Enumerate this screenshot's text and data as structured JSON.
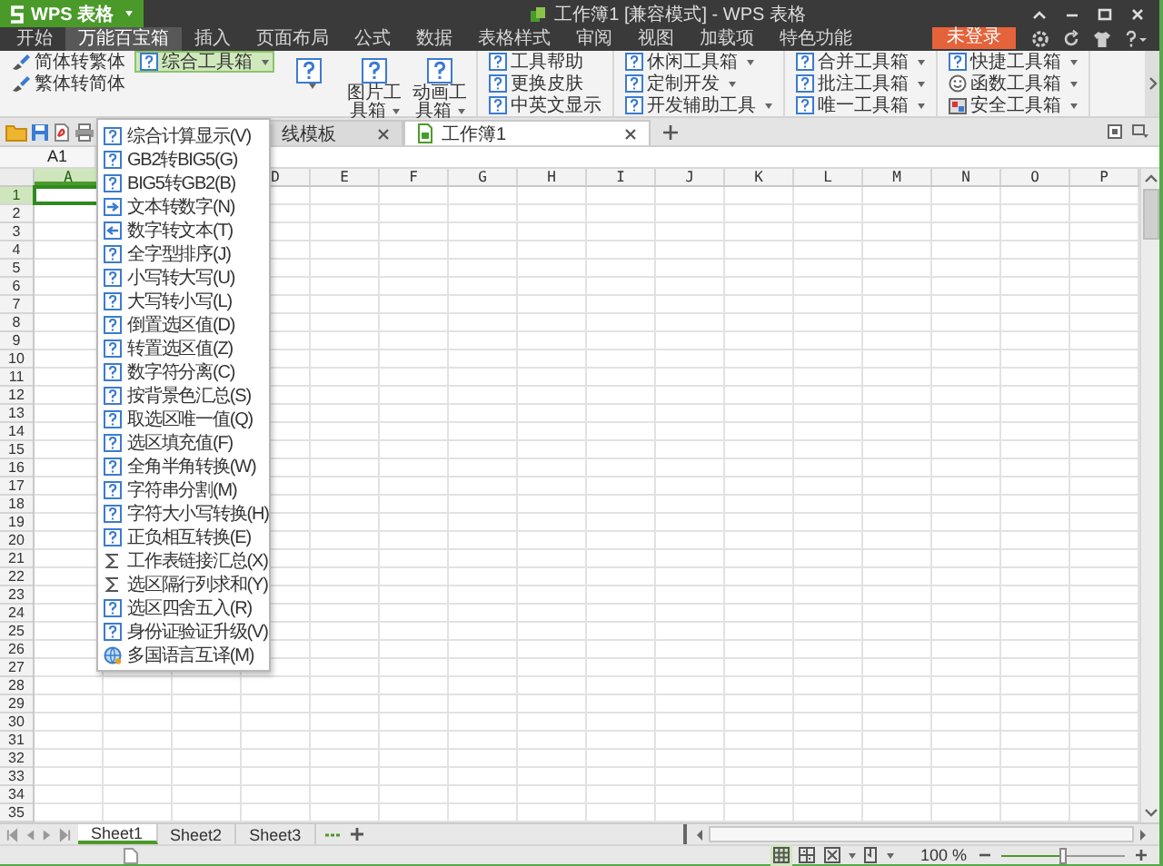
{
  "app_button": {
    "label": "WPS 表格"
  },
  "window": {
    "title": "工作簿1 [兼容模式] - WPS 表格"
  },
  "menu_tabs": [
    {
      "label": "开始",
      "selected": false
    },
    {
      "label": "万能百宝箱",
      "selected": true
    },
    {
      "label": "插入",
      "selected": false
    },
    {
      "label": "页面布局",
      "selected": false
    },
    {
      "label": "公式",
      "selected": false
    },
    {
      "label": "数据",
      "selected": false
    },
    {
      "label": "表格样式",
      "selected": false
    },
    {
      "label": "审阅",
      "selected": false
    },
    {
      "label": "视图",
      "selected": false
    },
    {
      "label": "加载项",
      "selected": false
    },
    {
      "label": "特色功能",
      "selected": false
    }
  ],
  "login_button": {
    "label": "未登录"
  },
  "ribbon": {
    "groups": [
      {
        "columns": [
          [
            {
              "kind": "brush",
              "label": "简体转繁体",
              "dropdown": false,
              "selected": false
            },
            {
              "kind": "brush",
              "label": "繁体转简体",
              "dropdown": false,
              "selected": false
            }
          ],
          [
            {
              "kind": "help",
              "label": "综合工具箱",
              "dropdown": true,
              "selected": true
            }
          ],
          [
            {
              "kind": "large",
              "dropdown": true,
              "selected": false
            }
          ],
          [
            {
              "kind": "large",
              "label": "图片工具箱",
              "dropdown": true,
              "selected": false
            }
          ],
          [
            {
              "kind": "large",
              "label": "动画工具箱",
              "dropdown": true,
              "selected": false
            }
          ]
        ]
      },
      {
        "columns": [
          [
            {
              "kind": "help",
              "label": "工具帮助",
              "dropdown": false,
              "selected": false
            },
            {
              "kind": "help",
              "label": "更换皮肤",
              "dropdown": false,
              "selected": false
            },
            {
              "kind": "help",
              "label": "中英文显示",
              "dropdown": false,
              "selected": false
            }
          ]
        ]
      },
      {
        "columns": [
          [
            {
              "kind": "help",
              "label": "休闲工具箱",
              "dropdown": true,
              "selected": false
            },
            {
              "kind": "help",
              "label": "定制开发",
              "dropdown": true,
              "selected": false
            },
            {
              "kind": "help",
              "label": "开发辅助工具",
              "dropdown": true,
              "selected": false
            }
          ]
        ]
      },
      {
        "columns": [
          [
            {
              "kind": "help",
              "label": "合并工具箱",
              "dropdown": true,
              "selected": false
            },
            {
              "kind": "help",
              "label": "批注工具箱",
              "dropdown": true,
              "selected": false
            },
            {
              "kind": "help",
              "label": "唯一工具箱",
              "dropdown": true,
              "selected": false
            }
          ]
        ]
      },
      {
        "columns": [
          [
            {
              "kind": "help",
              "label": "快捷工具箱",
              "dropdown": true,
              "selected": false
            },
            {
              "kind": "circle",
              "label": "函数工具箱",
              "dropdown": true,
              "selected": false
            },
            {
              "kind": "box",
              "label": "安全工具箱",
              "dropdown": true,
              "selected": false
            }
          ]
        ]
      }
    ]
  },
  "doc_tabs": [
    {
      "label": "线模板",
      "selected": false
    },
    {
      "label": "工作簿1",
      "selected": true
    }
  ],
  "name_box": "A1",
  "columns": [
    {
      "label": "A",
      "selected": true
    },
    {
      "covered": true
    },
    {
      "covered": true
    },
    {
      "label": "D",
      "selected": false
    },
    {
      "label": "E",
      "selected": false
    },
    {
      "label": "F",
      "selected": false
    },
    {
      "label": "G",
      "selected": false
    },
    {
      "label": "H",
      "selected": false
    },
    {
      "label": "I",
      "selected": false
    },
    {
      "label": "J",
      "selected": false
    },
    {
      "label": "K",
      "selected": false
    },
    {
      "label": "L",
      "selected": false
    },
    {
      "label": "M",
      "selected": false
    },
    {
      "label": "N",
      "selected": false
    },
    {
      "label": "O",
      "selected": false
    },
    {
      "label": "P",
      "selected": false
    }
  ],
  "rows": [
    {
      "label": "1",
      "selected": true
    },
    {
      "label": "2",
      "selected": false
    },
    {
      "label": "3",
      "selected": false
    },
    {
      "label": "4",
      "selected": false
    },
    {
      "label": "5",
      "selected": false
    },
    {
      "label": "6",
      "selected": false
    },
    {
      "label": "7",
      "selected": false
    },
    {
      "label": "8",
      "selected": false
    },
    {
      "label": "9",
      "selected": false
    },
    {
      "label": "10",
      "selected": false
    },
    {
      "label": "11",
      "selected": false
    },
    {
      "label": "12",
      "selected": false
    },
    {
      "label": "13",
      "selected": false
    },
    {
      "label": "14",
      "selected": false
    },
    {
      "label": "15",
      "selected": false
    },
    {
      "label": "16",
      "selected": false
    },
    {
      "label": "17",
      "selected": false
    },
    {
      "label": "18",
      "selected": false
    },
    {
      "label": "19",
      "selected": false
    },
    {
      "label": "20",
      "selected": false
    },
    {
      "label": "21",
      "selected": false
    },
    {
      "label": "22",
      "selected": false
    },
    {
      "label": "23",
      "selected": false
    },
    {
      "label": "24",
      "selected": false
    },
    {
      "label": "25",
      "selected": false
    },
    {
      "label": "26",
      "selected": false
    },
    {
      "label": "27",
      "selected": false
    },
    {
      "label": "28",
      "selected": false
    },
    {
      "label": "29",
      "selected": false
    },
    {
      "label": "30",
      "selected": false
    },
    {
      "label": "31",
      "selected": false
    },
    {
      "label": "32",
      "selected": false
    },
    {
      "label": "33",
      "selected": false
    },
    {
      "label": "34",
      "selected": false
    },
    {
      "label": "35",
      "selected": false
    }
  ],
  "dropdown_menu": {
    "items": [
      {
        "kind": "help",
        "label": "综合计算显示(V)"
      },
      {
        "kind": "help",
        "label": "GB2转BIG5(G)"
      },
      {
        "kind": "help",
        "label": "BIG5转GB2(B)"
      },
      {
        "kind": "to_number",
        "label": "文本转数字(N)"
      },
      {
        "kind": "to_text",
        "label": "数字转文本(T)"
      },
      {
        "kind": "help",
        "label": "全字型排序(J)"
      },
      {
        "kind": "help",
        "label": "小写转大写(U)"
      },
      {
        "kind": "help",
        "label": "大写转小写(L)"
      },
      {
        "kind": "help",
        "label": "倒置选区值(D)"
      },
      {
        "kind": "help",
        "label": "转置选区值(Z)"
      },
      {
        "kind": "help",
        "label": "数字符分离(C)"
      },
      {
        "kind": "help",
        "label": "按背景色汇总(S)"
      },
      {
        "kind": "help",
        "label": "取选区唯一值(Q)"
      },
      {
        "kind": "help",
        "label": "选区填充值(F)"
      },
      {
        "kind": "help",
        "label": "全角半角转换(W)"
      },
      {
        "kind": "help",
        "label": "字符串分割(M)"
      },
      {
        "kind": "help",
        "label": "字符大小写转换(H)"
      },
      {
        "kind": "help",
        "label": "正负相互转换(E)"
      },
      {
        "kind": "sum",
        "label": "工作表链接汇总(X)"
      },
      {
        "kind": "sum",
        "label": "选区隔行列求和(Y)"
      },
      {
        "kind": "help",
        "label": "选区四舍五入(R)"
      },
      {
        "kind": "help",
        "label": "身份证验证升级(V)"
      },
      {
        "kind": "globe",
        "label": "多国语言互译(M)"
      }
    ]
  },
  "sheet_tabs": [
    {
      "label": "Sheet1",
      "selected": true
    },
    {
      "label": "Sheet2",
      "selected": false
    },
    {
      "label": "Sheet3",
      "selected": false
    }
  ],
  "status_bar": {
    "view_buttons": [
      {
        "kind": "normal",
        "selected": true
      },
      {
        "kind": "page_break",
        "selected": false
      },
      {
        "kind": "full_screen",
        "selected": false
      },
      {
        "kind": "reading",
        "selected": false
      }
    ],
    "zoom": "100 %",
    "zoom_slider": {
      "level": 0.5
    }
  }
}
